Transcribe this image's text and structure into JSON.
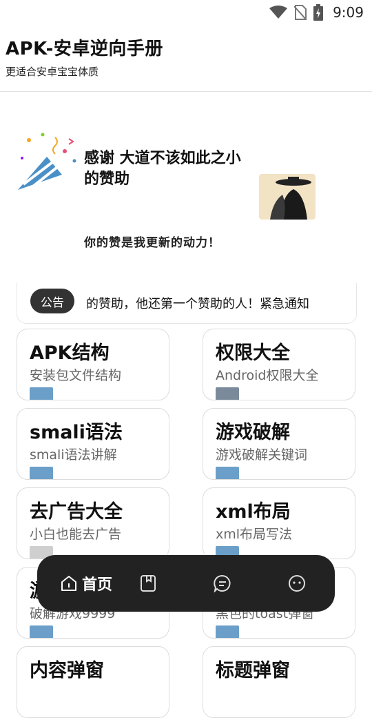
{
  "status_bar": {
    "time": "9:09",
    "icons": [
      "wifi-icon",
      "no-sim-icon",
      "battery-charging-icon"
    ]
  },
  "header": {
    "title": "APK-安卓逆向手册",
    "subtitle": "更适合安卓宝宝体质"
  },
  "banner": {
    "line1": "感谢  大道不该如此之小",
    "line2": "的赞助",
    "subtitle": "你的赞是我更新的动力！"
  },
  "notice": {
    "badge": "公告",
    "text": "的赞助，他还第一个赞助的人！紧急通知"
  },
  "cards": [
    {
      "title": "APK结构",
      "subtitle": "安装包文件结构"
    },
    {
      "title": "权限大全",
      "subtitle": "Android权限大全"
    },
    {
      "title": "smali语法",
      "subtitle": "smali语法讲解"
    },
    {
      "title": "游戏破解",
      "subtitle": "游戏破解关键词"
    },
    {
      "title": "去广告大全",
      "subtitle": "小白也能去广告"
    },
    {
      "title": " xml布局",
      "subtitle": "xml布局写法"
    },
    {
      "title": "游",
      "subtitle": "破解游戏9999"
    },
    {
      "title": "",
      "subtitle": "黑色的toast弹窗"
    },
    {
      "title": "内容弹窗",
      "subtitle": ""
    },
    {
      "title": "标题弹窗",
      "subtitle": ""
    }
  ],
  "nav": {
    "home_label": "首页",
    "items": [
      "home-icon",
      "bookmark-icon",
      "message-icon",
      "profile-icon"
    ]
  },
  "colors": {
    "nav_background": "#222222",
    "badge_background": "#333333",
    "thumb_blue": "#6b9fc9"
  }
}
